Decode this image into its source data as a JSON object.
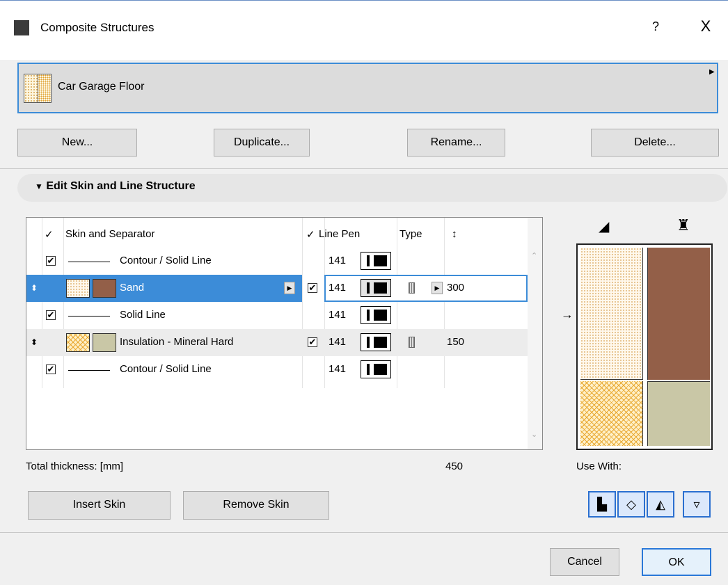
{
  "window": {
    "title": "Composite Structures",
    "help": "?",
    "close": "X"
  },
  "structure": {
    "name": "Car Garage Floor"
  },
  "buttons": {
    "new": "New...",
    "duplicate": "Duplicate...",
    "rename": "Rename...",
    "delete": "Delete..."
  },
  "section": {
    "title": "Edit Skin and Line Structure"
  },
  "table": {
    "headers": {
      "check": "✓",
      "skin": "Skin and Separator",
      "lines_check": "✓",
      "line_pen": "Line Pen",
      "type": "Type",
      "thickness_icon": "↕"
    },
    "rows": [
      {
        "kind": "line",
        "checked": true,
        "name": "Contour / Solid Line",
        "pen": "141"
      },
      {
        "kind": "skin",
        "selected": true,
        "name": "Sand",
        "checked": true,
        "pen": "141",
        "thickness": "300",
        "fill_color": "#935f48"
      },
      {
        "kind": "line",
        "checked": true,
        "name": "Solid Line",
        "pen": "141"
      },
      {
        "kind": "skin",
        "name": "Insulation - Mineral Hard",
        "checked": true,
        "pen": "141",
        "thickness": "150",
        "fill_color": "#c9c7a6"
      },
      {
        "kind": "line",
        "checked": true,
        "name": "Contour / Solid Line",
        "pen": "141"
      }
    ]
  },
  "totals": {
    "label": "Total thickness: [mm]",
    "value": "450"
  },
  "skin_buttons": {
    "insert": "Insert Skin",
    "remove": "Remove Skin"
  },
  "use_with": {
    "label": "Use With:",
    "icons": [
      "wall-icon",
      "slab-icon",
      "roof-icon",
      "shell-icon"
    ]
  },
  "dialog": {
    "cancel": "Cancel",
    "ok": "OK"
  },
  "colors": {
    "accent": "#3c8cd8",
    "selection": "#3c8cd8"
  }
}
